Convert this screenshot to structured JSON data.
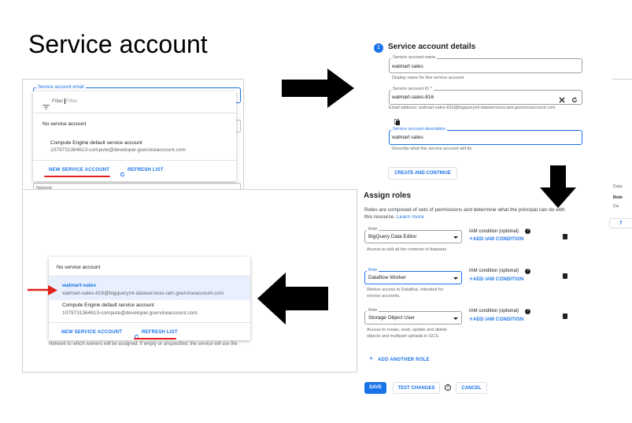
{
  "title": "Service account",
  "panel_a": {
    "field_label": "Service account email",
    "filter_label": "Filter",
    "filter_placeholder": "Filter",
    "items": [
      {
        "name": "No service account",
        "email": ""
      },
      {
        "name": "Compute Engine default service account",
        "email": "1079731364613-compute@developer.gserviceaccount.com"
      }
    ],
    "new_button": "NEW SERVICE ACCOUNT",
    "refresh_button": "REFRESH LIST",
    "network_label": "Network"
  },
  "details": {
    "step": "1",
    "title": "Service account details",
    "name_label": "Service account name",
    "name_value": "walmart sales",
    "name_hint": "Display name for this service account",
    "id_label": "Service account ID *",
    "id_value": "walmart-sales-816",
    "email_hint": "Email address: walmart-sales-816@bigqueryml-dataservices.iam.gserviceaccount.com",
    "desc_label": "Service account description",
    "desc_value": "walmart sales",
    "desc_hint": "Describe what this service account will do",
    "create_button": "CREATE AND CONTINUE"
  },
  "roles": {
    "title": "Assign roles",
    "description": "Roles are composed of sets of permissions and determine what the principal can do with this resource.",
    "learn_more": "Learn more",
    "items": [
      {
        "label": "Role",
        "value": "BigQuery Data Editor",
        "desc": "Access to edit all the contents of datasets",
        "condition_label": "IAM condition (optional)",
        "add_condition": "ADD IAM CONDITION"
      },
      {
        "label": "Role",
        "value": "Dataflow Worker",
        "desc": "Worker access to Dataflow. Intended for service accounts.",
        "condition_label": "IAM condition (optional)",
        "add_condition": "ADD IAM CONDITION"
      },
      {
        "label": "Role",
        "value": "Storage Object User",
        "desc": "Access to create, read, update and delete objects and multipart uploads in GCS.",
        "condition_label": "IAM condition (optional)",
        "add_condition": "ADD IAM CONDITION"
      }
    ],
    "add_role": "ADD ANOTHER ROLE",
    "save": "SAVE",
    "test_changes": "TEST CHANGES",
    "cancel": "CANCEL"
  },
  "panel_d": {
    "items": [
      {
        "name": "No service account",
        "email": ""
      },
      {
        "name": "walmart-sales",
        "email": "walmart-sales-816@bigqueryml-dataservices.iam.gserviceaccount.com"
      },
      {
        "name": "Compute Engine default service account",
        "email": "1079731364613-compute@developer.gserviceaccount.com"
      }
    ],
    "new_button": "NEW SERVICE ACCOUNT",
    "refresh_button": "REFRESH LIST",
    "network_hint": "Network to which workers will be assigned. If empty or unspecified, the service will use the"
  },
  "edge": {
    "a": "Data",
    "b": "Role",
    "c": "Da",
    "d": "T"
  },
  "colors": {
    "accent": "#1a73e8",
    "highlight": "#e0201b"
  }
}
